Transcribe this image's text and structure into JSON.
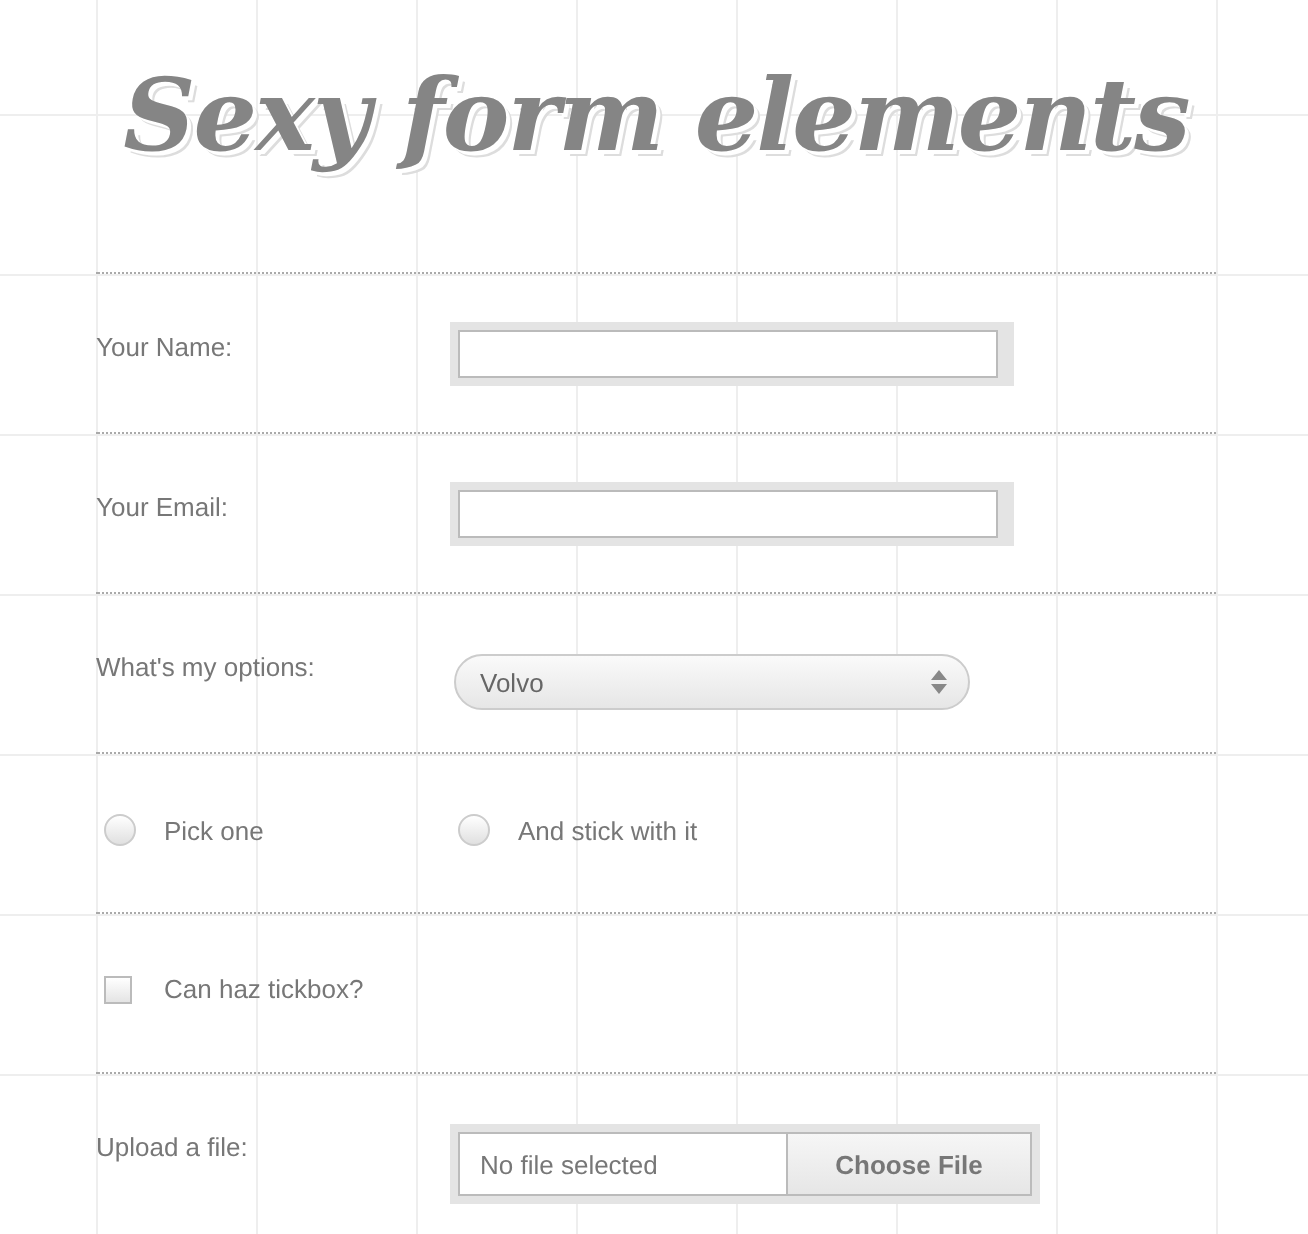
{
  "title": "Sexy form elements",
  "rows": [
    {
      "kind": "text",
      "label": "Your Name:"
    },
    {
      "kind": "text",
      "label": "Your Email:"
    },
    {
      "kind": "select",
      "label": "What's my options:",
      "value": "Volvo"
    },
    {
      "kind": "radios",
      "options": [
        {
          "label": "Pick one",
          "selected": false
        },
        {
          "label": "And stick with it",
          "selected": false
        }
      ]
    },
    {
      "kind": "checkbox",
      "label": "Can haz tickbox?",
      "checked": false
    },
    {
      "kind": "file",
      "label": "Upload a file:",
      "status": "No file selected",
      "button": "Choose File"
    }
  ]
}
